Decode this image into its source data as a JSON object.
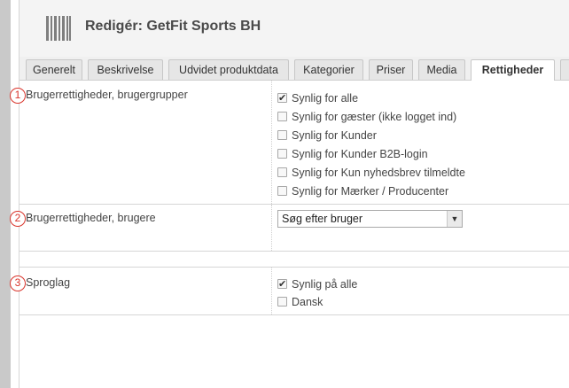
{
  "page": {
    "title": "Redigér: GetFit Sports BH"
  },
  "tabs": [
    {
      "label": "Generelt",
      "active": false
    },
    {
      "label": "Beskrivelse",
      "active": false
    },
    {
      "label": "Udvidet produktdata",
      "active": false
    },
    {
      "label": "Kategorier",
      "active": false
    },
    {
      "label": "Priser",
      "active": false
    },
    {
      "label": "Media",
      "active": false
    },
    {
      "label": "Rettigheder",
      "active": true
    }
  ],
  "sections": {
    "groups": {
      "marker": "1",
      "label": "Brugerrettigheder, brugergrupper",
      "options": [
        {
          "label": "Synlig for alle",
          "checked": true
        },
        {
          "label": "Synlig for gæster (ikke logget ind)",
          "checked": false
        },
        {
          "label": "Synlig for Kunder",
          "checked": false
        },
        {
          "label": "Synlig for Kunder B2B-login",
          "checked": false
        },
        {
          "label": "Synlig for Kun nyhedsbrev tilmeldte",
          "checked": false
        },
        {
          "label": "Synlig for Mærker / Producenter",
          "checked": false
        }
      ]
    },
    "users": {
      "marker": "2",
      "label": "Brugerrettigheder, brugere",
      "select_value": "Søg efter bruger",
      "arrow_icon": "chevron-down-icon"
    },
    "language": {
      "marker": "3",
      "label": "Sproglag",
      "options": [
        {
          "label": "Synlig på alle",
          "checked": true
        },
        {
          "label": "Dansk",
          "checked": false
        }
      ]
    }
  },
  "colors": {
    "marker": "#d9342b",
    "logo": "#7f7f7f"
  }
}
